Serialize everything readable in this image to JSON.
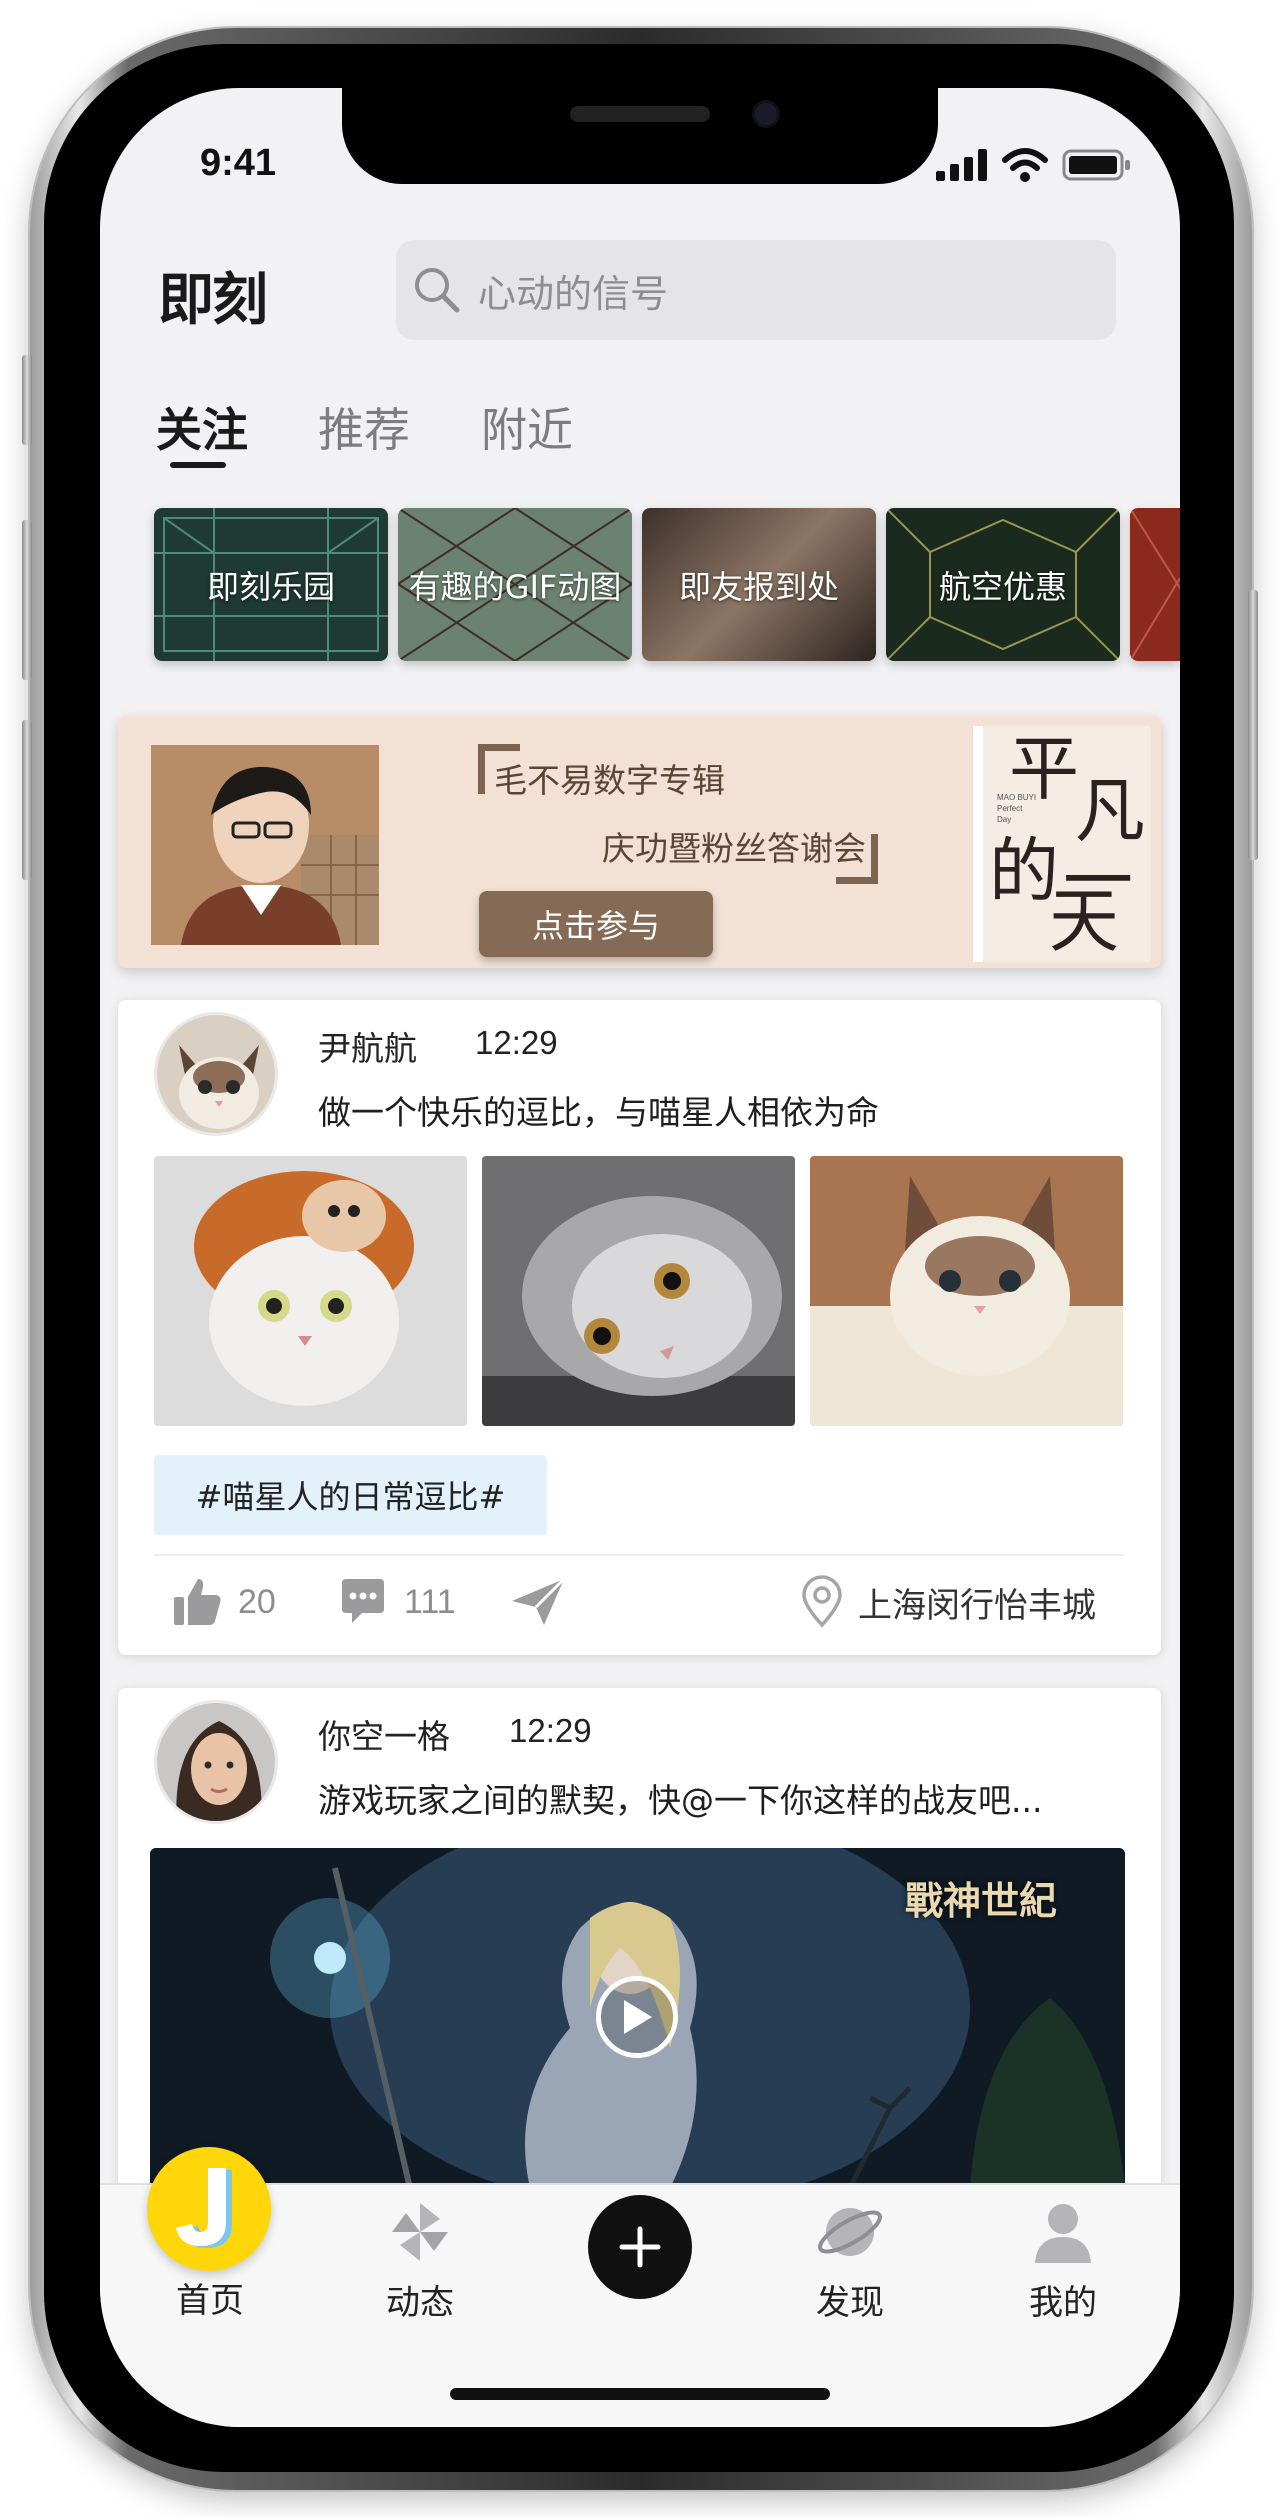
{
  "status_bar": {
    "time": "9:41"
  },
  "header": {
    "logo": "即刻",
    "search_placeholder": "心动的信号"
  },
  "tabs": [
    {
      "label": "关注",
      "active": true
    },
    {
      "label": "推荐",
      "active": false
    },
    {
      "label": "附近",
      "active": false
    }
  ],
  "topics": [
    {
      "label": "即刻乐园",
      "color": "#1f3a32"
    },
    {
      "label": "有趣的GIF动图",
      "color": "#6b8270"
    },
    {
      "label": "即友报到处",
      "color": "#5a4a3e"
    },
    {
      "label": "航空优惠",
      "color": "#1b2a1f"
    },
    {
      "label": "",
      "color": "#8a2a1c"
    }
  ],
  "banner": {
    "line1": "毛不易数字专辑",
    "line2": "庆功暨粉丝答谢会",
    "button": "点击参与",
    "album_title_a": "平",
    "album_title_b": "凡",
    "album_title_c": "的",
    "album_title_d": "一",
    "album_title_e": "天",
    "album_mini": "MAO BUYI\nPerfect\nDay"
  },
  "posts": [
    {
      "username": "尹航航",
      "time": "12:29",
      "text": "做一个快乐的逗比，与喵星人相依为命",
      "hashtag": "#喵星人的日常逗比#",
      "likes": "20",
      "comments": "111",
      "location": "上海闵行怡丰城"
    },
    {
      "username": "你空一格",
      "time": "12:29",
      "text": "游戏玩家之间的默契，快@一下你这样的战友吧...",
      "video_logo": "戰神世紀"
    }
  ],
  "tabbar": {
    "items": [
      {
        "label": "首页",
        "icon": "home-j-icon"
      },
      {
        "label": "动态",
        "icon": "pinwheel-icon"
      },
      {
        "label": "",
        "icon": "plus-icon"
      },
      {
        "label": "发现",
        "icon": "planet-icon"
      },
      {
        "label": "我的",
        "icon": "person-icon"
      }
    ]
  },
  "colors": {
    "accent_yellow": "#ffd60a",
    "hashtag_bg": "#e3f1fb",
    "banner_bg": "#f2e1d4",
    "banner_button": "#856a55"
  }
}
